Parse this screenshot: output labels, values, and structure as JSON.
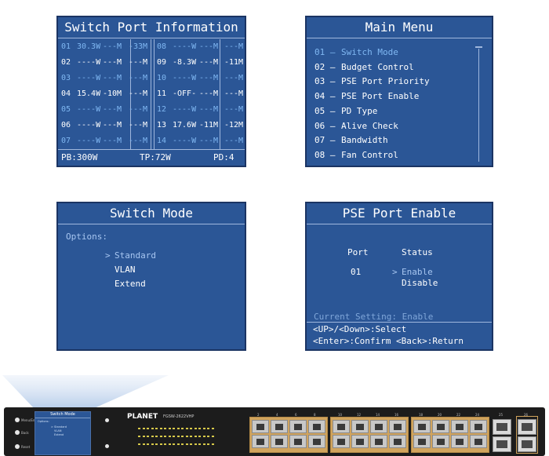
{
  "switch_port_info": {
    "title": "Switch Port Information",
    "rows": [
      {
        "left": {
          "port": "01",
          "power": "30.3W",
          "speed1": "---M",
          "speed2": "-33M",
          "active": false
        },
        "right": {
          "port": "08",
          "power": "----W",
          "speed1": "---M",
          "speed2": "---M",
          "active": false
        }
      },
      {
        "left": {
          "port": "02",
          "power": "----W",
          "speed1": "---M",
          "speed2": "---M",
          "active": true
        },
        "right": {
          "port": "09",
          "power": "-8.3W",
          "speed1": "---M",
          "speed2": "-11M",
          "active": true
        }
      },
      {
        "left": {
          "port": "03",
          "power": "----W",
          "speed1": "---M",
          "speed2": "---M",
          "active": false
        },
        "right": {
          "port": "10",
          "power": "----W",
          "speed1": "---M",
          "speed2": "---M",
          "active": false
        }
      },
      {
        "left": {
          "port": "04",
          "power": "15.4W",
          "speed1": "-10M",
          "speed2": "---M",
          "active": true
        },
        "right": {
          "port": "11",
          "power": "-OFF-",
          "speed1": "---M",
          "speed2": "---M",
          "active": true
        }
      },
      {
        "left": {
          "port": "05",
          "power": "----W",
          "speed1": "---M",
          "speed2": "---M",
          "active": false
        },
        "right": {
          "port": "12",
          "power": "----W",
          "speed1": "---M",
          "speed2": "---M",
          "active": false
        }
      },
      {
        "left": {
          "port": "06",
          "power": "----W",
          "speed1": "---M",
          "speed2": "---M",
          "active": true
        },
        "right": {
          "port": "13",
          "power": "17.6W",
          "speed1": "-11M",
          "speed2": "-12M",
          "active": true
        }
      },
      {
        "left": {
          "port": "07",
          "power": "----W",
          "speed1": "---M",
          "speed2": "---M",
          "active": false
        },
        "right": {
          "port": "14",
          "power": "----W",
          "speed1": "---M",
          "speed2": "---M",
          "active": false
        }
      }
    ],
    "footer": {
      "pb": "PB:300W",
      "tp": "TP:72W",
      "pd": "PD:4"
    }
  },
  "main_menu": {
    "title": "Main Menu",
    "items": [
      {
        "num": "01 –",
        "label": "Switch Mode",
        "selected": true
      },
      {
        "num": "02 –",
        "label": "Budget Control",
        "selected": false
      },
      {
        "num": "03 –",
        "label": "PSE Port Priority",
        "selected": false
      },
      {
        "num": "04 –",
        "label": "PSE Port Enable",
        "selected": false
      },
      {
        "num": "05 –",
        "label": "PD Type",
        "selected": false
      },
      {
        "num": "06 –",
        "label": "Alive Check",
        "selected": false
      },
      {
        "num": "07 –",
        "label": "Bandwidth",
        "selected": false
      },
      {
        "num": "08 –",
        "label": "Fan Control",
        "selected": false
      }
    ]
  },
  "switch_mode": {
    "title": "Switch Mode",
    "options_label": "Options:",
    "cursor": ">",
    "options": [
      "Standard",
      "VLAN",
      "Extend"
    ],
    "selected_index": 0
  },
  "pse_port_enable": {
    "title": "PSE Port Enable",
    "port_header": "Port",
    "status_header": "Status",
    "port_value": "01",
    "cursor": ">",
    "status_options": [
      "Enable",
      "Disable"
    ],
    "current_setting": "Current Setting: Enable",
    "help_line1": "<UP>/<Down>:Select",
    "help_line2": "<Enter>:Confirm <Back>:Return"
  },
  "device": {
    "brand": "PLANET",
    "model": "FGSW-2622VHP",
    "lcd_title": "Switch Mode",
    "lcd_options_label": "Options:",
    "lcd_options": [
      "> Standard",
      "VLAN",
      "Extend"
    ],
    "button_labels": [
      "Menu/Enter",
      "Back",
      "Reset"
    ],
    "rj45_port_numbers": [
      "2",
      "4",
      "6",
      "8",
      "10",
      "12",
      "14",
      "16",
      "18",
      "20",
      "22",
      "24"
    ],
    "sfp_port_numbers": [
      "25",
      "26"
    ],
    "colors": {
      "lcd_bg": "#2b5696",
      "port_block": "#d1a45d",
      "chassis": "#1c1c1c"
    }
  }
}
